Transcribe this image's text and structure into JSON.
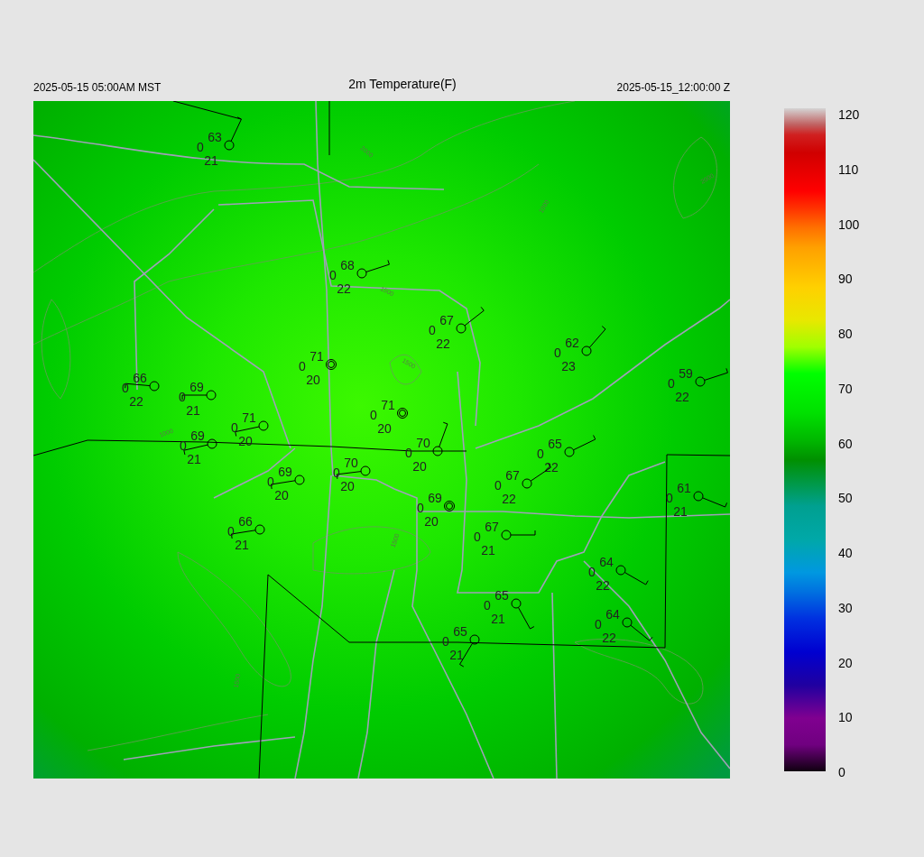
{
  "header": {
    "valid_local": "2025-05-15 05:00AM MST",
    "title": "2m Temperature(F)",
    "valid_utc": "2025-05-15_12:00:00 Z"
  },
  "map": {
    "contour_labels": [
      "2000",
      "1500",
      "1500",
      "1000",
      "1500",
      "1000",
      "2000",
      "1500"
    ],
    "stations": [
      {
        "kind": "wind",
        "temperature": "63",
        "cloud": "0",
        "dewpoint": "21"
      },
      {
        "kind": "wind",
        "temperature": "68",
        "cloud": "0",
        "dewpoint": "22"
      },
      {
        "kind": "wind",
        "temperature": "67",
        "cloud": "0",
        "dewpoint": "22"
      },
      {
        "kind": "wind",
        "temperature": "62",
        "cloud": "0",
        "dewpoint": "23"
      },
      {
        "kind": "calm",
        "temperature": "71",
        "cloud": "0",
        "dewpoint": "20"
      },
      {
        "kind": "wind",
        "temperature": "66",
        "cloud": "0",
        "dewpoint": "22"
      },
      {
        "kind": "wind",
        "temperature": "69",
        "cloud": "0",
        "dewpoint": "21"
      },
      {
        "kind": "wind",
        "temperature": "59",
        "cloud": "0",
        "dewpoint": "22"
      },
      {
        "kind": "calm",
        "temperature": "71",
        "cloud": "0",
        "dewpoint": "20"
      },
      {
        "kind": "wind",
        "temperature": "71",
        "cloud": "0",
        "dewpoint": "20"
      },
      {
        "kind": "wind",
        "temperature": "69",
        "cloud": "0",
        "dewpoint": "21"
      },
      {
        "kind": "wind",
        "temperature": "70",
        "cloud": "0",
        "dewpoint": "20"
      },
      {
        "kind": "wind",
        "temperature": "65",
        "cloud": "0",
        "dewpoint": "22"
      },
      {
        "kind": "wind",
        "temperature": "69",
        "cloud": "0",
        "dewpoint": "20"
      },
      {
        "kind": "wind",
        "temperature": "70",
        "cloud": "0",
        "dewpoint": "20"
      },
      {
        "kind": "wind",
        "temperature": "67",
        "cloud": "0",
        "dewpoint": "22"
      },
      {
        "kind": "calm",
        "temperature": "69",
        "cloud": "0",
        "dewpoint": "20"
      },
      {
        "kind": "wind",
        "temperature": "61",
        "cloud": "0",
        "dewpoint": "21"
      },
      {
        "kind": "wind",
        "temperature": "66",
        "cloud": "0",
        "dewpoint": "21"
      },
      {
        "kind": "wind",
        "temperature": "67",
        "cloud": "0",
        "dewpoint": "21"
      },
      {
        "kind": "wind",
        "temperature": "64",
        "cloud": "0",
        "dewpoint": "22"
      },
      {
        "kind": "wind",
        "temperature": "65",
        "cloud": "0",
        "dewpoint": "21"
      },
      {
        "kind": "wind",
        "temperature": "64",
        "cloud": "0",
        "dewpoint": "22"
      },
      {
        "kind": "wind",
        "temperature": "65",
        "cloud": "0",
        "dewpoint": "21"
      }
    ]
  },
  "colorbar": {
    "ticks": [
      "120",
      "110",
      "100",
      "90",
      "80",
      "70",
      "60",
      "50",
      "40",
      "30",
      "20",
      "10",
      "0"
    ]
  }
}
